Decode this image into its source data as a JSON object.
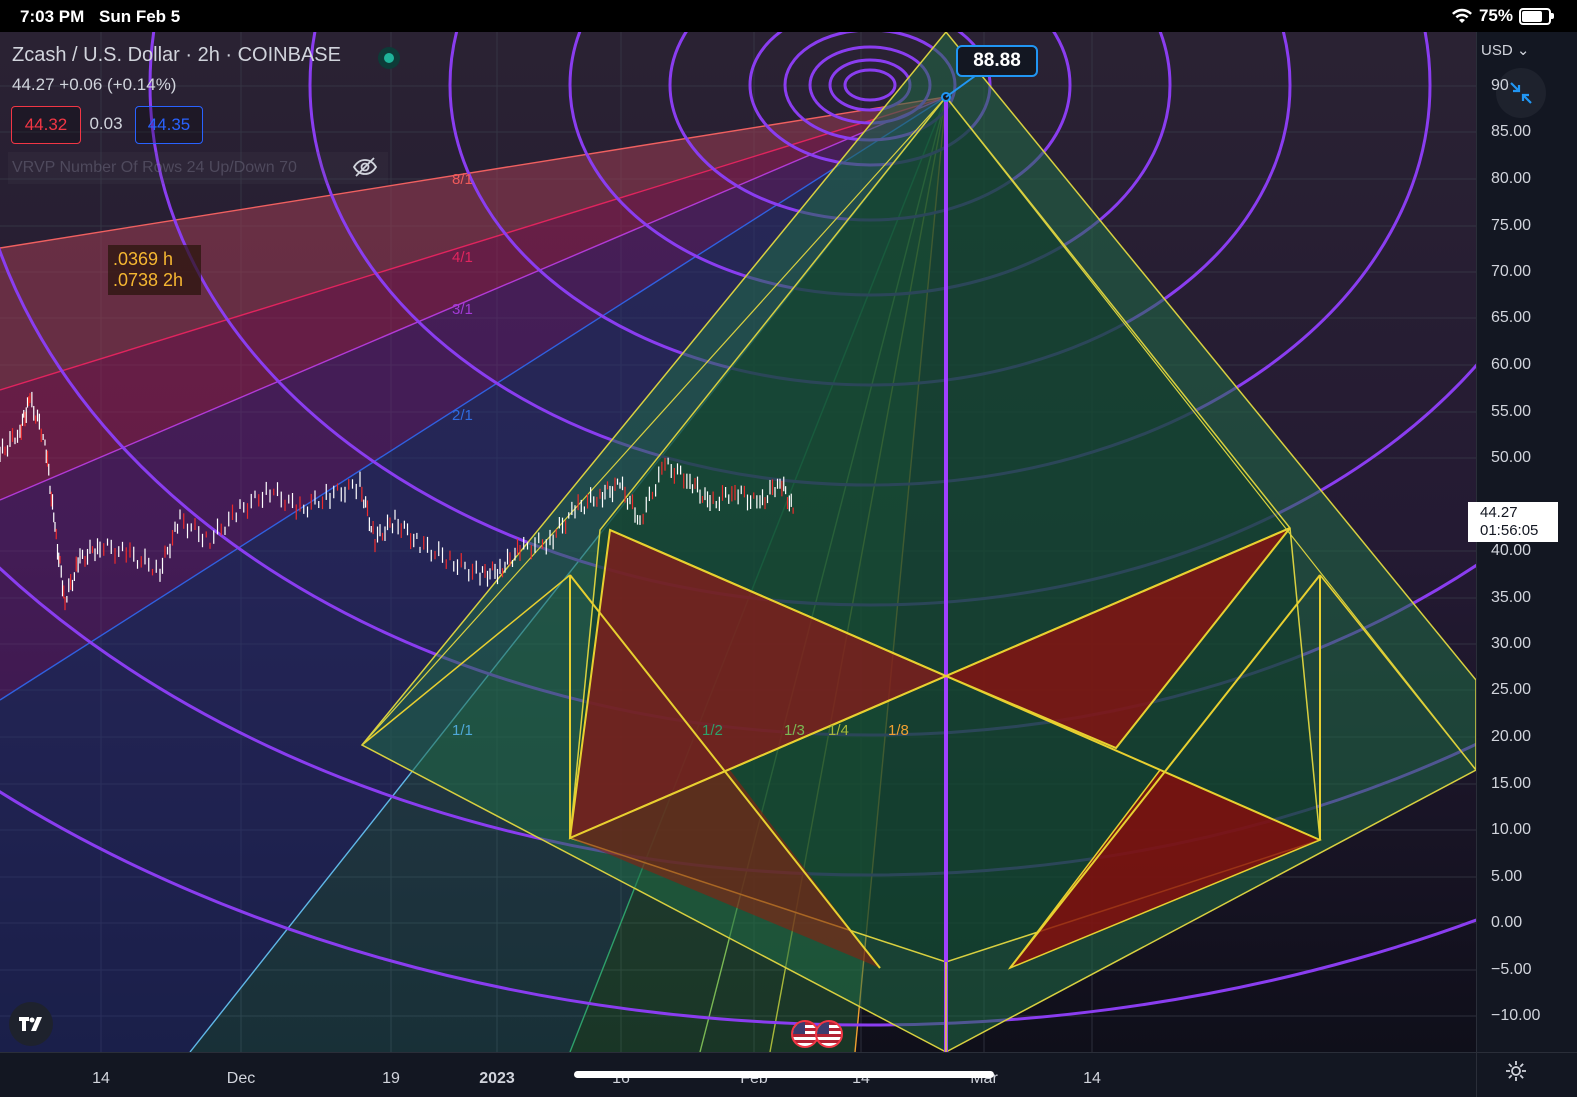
{
  "status_bar": {
    "time": "7:03 PM",
    "date": "Sun Feb 5",
    "battery": "75%"
  },
  "symbol": {
    "title": "Zcash / U.S. Dollar · 2h · COINBASE",
    "last": "44.27",
    "change": "+0.06 (+0.14%)"
  },
  "trade": {
    "sell": "44.32",
    "spread": "0.03",
    "buy": "44.35"
  },
  "indicator": {
    "label": "VRVP Number Of Rows 24 Up/Down 70",
    "icon": "eye-off-icon"
  },
  "annotation": {
    "line1": ".0369 h",
    "line2": ".0738 2h"
  },
  "gann_fan": {
    "upper_labels": [
      {
        "text": "8/1",
        "color": "#f05a5a"
      },
      {
        "text": "4/1",
        "color": "#e0245e"
      },
      {
        "text": "3/1",
        "color": "#a33ad6"
      },
      {
        "text": "2/1",
        "color": "#2f6be0"
      }
    ],
    "lower_labels": [
      {
        "text": "1/1",
        "color": "#4fa8d8"
      },
      {
        "text": "1/2",
        "color": "#2ea06a"
      },
      {
        "text": "1/3",
        "color": "#7ab854"
      },
      {
        "text": "1/4",
        "color": "#a8b83a"
      },
      {
        "text": "1/8",
        "color": "#f0a030"
      }
    ]
  },
  "callout": {
    "value": "88.88"
  },
  "price_axis": {
    "currency": "USD",
    "labels": [
      "90",
      "85.00",
      "80.00",
      "75.00",
      "70.00",
      "65.00",
      "60.00",
      "55.00",
      "50.00",
      "40.00",
      "35.00",
      "30.00",
      "25.00",
      "20.00",
      "15.00",
      "10.00",
      "5.00",
      "0.00",
      "−5.00",
      "−10.00"
    ],
    "current_price": "44.27",
    "countdown": "01:56:05"
  },
  "time_axis": {
    "labels": [
      "14",
      "Dec",
      "19",
      "2023",
      "16",
      "Feb",
      "14",
      "Mar",
      "14"
    ],
    "bold": "2023"
  },
  "colors": {
    "background": "#131722",
    "arc": "#8a3df0",
    "pyramid_fill": "#1f6b45",
    "pyramid_line": "#d8d040",
    "red_fill": "#8b1a1a",
    "candle_up": "#ffffff",
    "candle_down": "#ef2b2b"
  }
}
